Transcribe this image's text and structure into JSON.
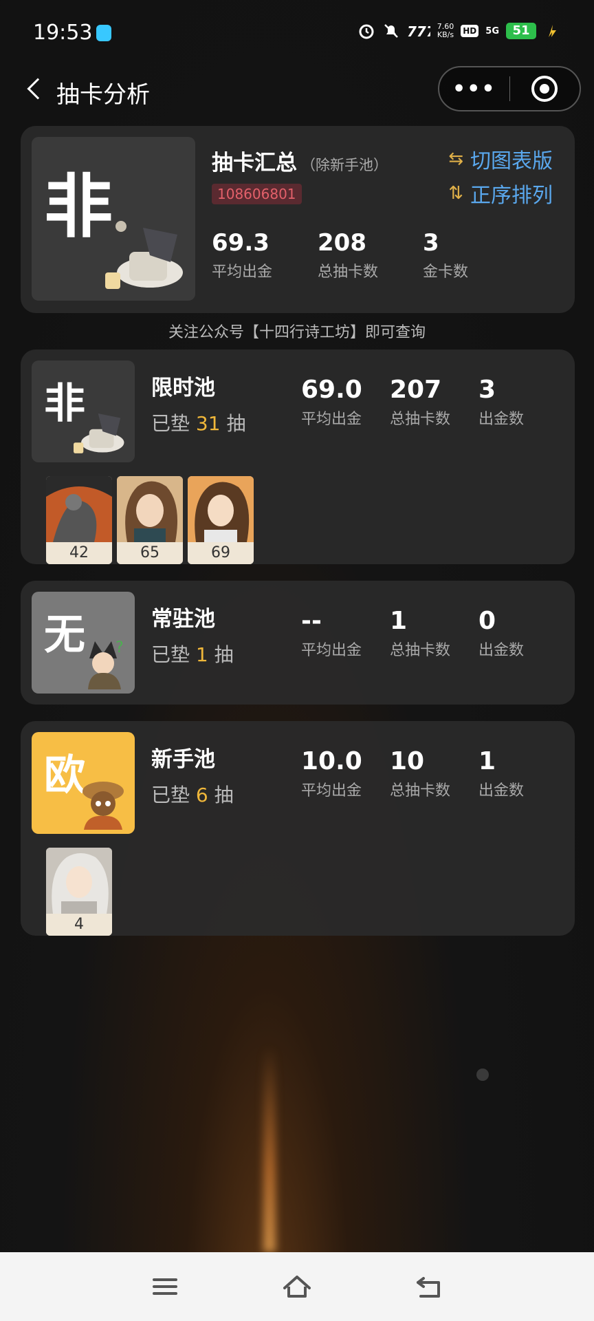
{
  "status_bar": {
    "time": "19:53",
    "net_speed": "7.60",
    "net_unit": "KB/s",
    "hd": "HD",
    "signal": "5G",
    "battery": "51"
  },
  "nav": {
    "title": "抽卡分析",
    "more_icon": "•••"
  },
  "summary": {
    "badge": "非",
    "title": "抽卡汇总",
    "subtitle": "（除新手池）",
    "uid": "108606801",
    "switch_label": "切图表版",
    "sort_label": "正序排列",
    "stats": [
      {
        "value": "69.3",
        "label": "平均出金"
      },
      {
        "value": "208",
        "label": "总抽卡数"
      },
      {
        "value": "3",
        "label": "金卡数"
      }
    ]
  },
  "notice": "关注公众号【十四行诗工坊】即可查询",
  "pools": [
    {
      "badge": "非",
      "name": "限时池",
      "pad_prefix": "已垫",
      "pad_count": "31",
      "pad_suffix": "抽",
      "stats": [
        {
          "value": "69.0",
          "label": "平均出金"
        },
        {
          "value": "207",
          "label": "总抽卡数"
        },
        {
          "value": "3",
          "label": "出金数"
        }
      ],
      "characters": [
        "42",
        "65",
        "69"
      ]
    },
    {
      "badge": "无",
      "name": "常驻池",
      "pad_prefix": "已垫",
      "pad_count": "1",
      "pad_suffix": "抽",
      "stats": [
        {
          "value": "--",
          "label": "平均出金"
        },
        {
          "value": "1",
          "label": "总抽卡数"
        },
        {
          "value": "0",
          "label": "出金数"
        }
      ],
      "characters": []
    },
    {
      "badge": "欧",
      "name": "新手池",
      "pad_prefix": "已垫",
      "pad_count": "6",
      "pad_suffix": "抽",
      "stats": [
        {
          "value": "10.0",
          "label": "平均出金"
        },
        {
          "value": "10",
          "label": "总抽卡数"
        },
        {
          "value": "1",
          "label": "出金数"
        }
      ],
      "characters": [
        "4"
      ]
    }
  ],
  "colors": {
    "accent_blue": "#5aa8ee",
    "accent_gold": "#f0b73a",
    "uid_bg": "#5a2a30",
    "uid_text": "#e3606a",
    "badge_fei": "#3a3a3a",
    "badge_wu": "#7a7a7a",
    "badge_ou": "#f7be45"
  }
}
